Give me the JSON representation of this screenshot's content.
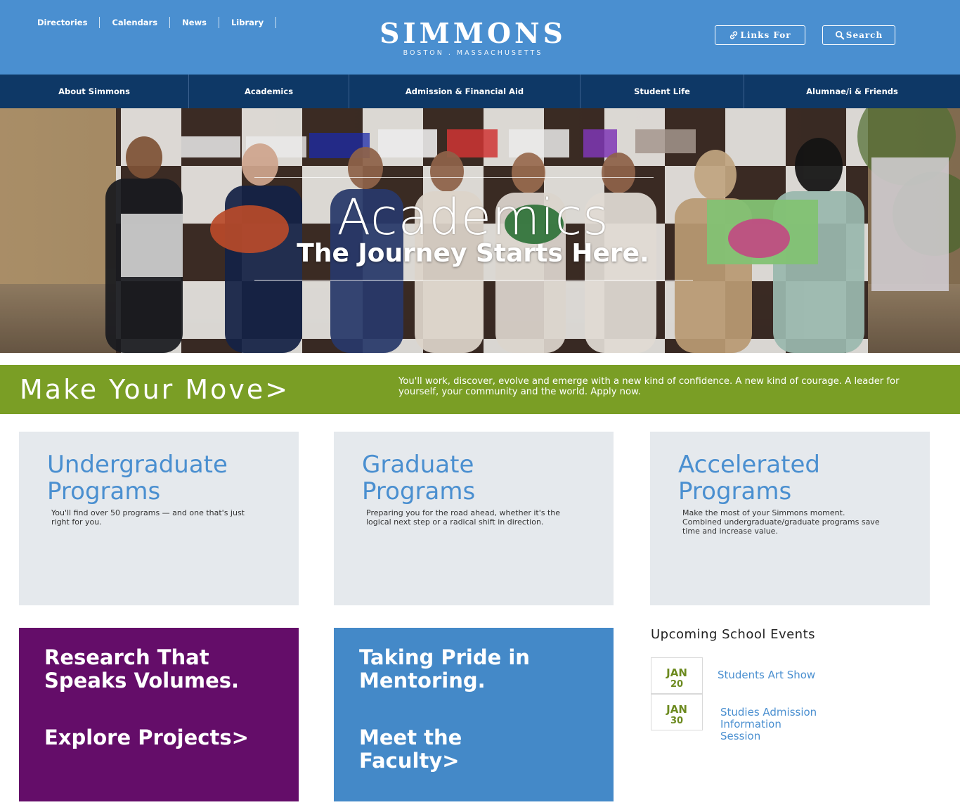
{
  "utility_nav": [
    "Directories",
    "Calendars",
    "News",
    "Library"
  ],
  "brand": {
    "name": "SIMMONS",
    "location": "BOSTON . MASSACHUSETTS"
  },
  "header_buttons": {
    "links_for": "Links For",
    "search": "Search"
  },
  "main_nav": [
    "About Simmons",
    "Academics",
    "Admission & Financial Aid",
    "Student Life",
    "Alumnae/i & Friends"
  ],
  "hero": {
    "title": "Academics",
    "subtitle": "The Journey Starts Here."
  },
  "move": {
    "title": "Make Your Move>",
    "text": "You'll work, discover, evolve and emerge with a new kind of confidence. A new kind of courage. A leader for yourself, your community and the world. Apply now."
  },
  "programs": [
    {
      "title_line1": "Undergraduate",
      "title_line2": "Programs",
      "description": "You'll find over 50 programs — and one that's just right for you."
    },
    {
      "title_line1": "Graduate",
      "title_line2": "Programs",
      "description": "Preparing you for the road ahead, whether it's the logical next step or a radical shift in direction."
    },
    {
      "title_line1": "Accelerated",
      "title_line2": "Programs",
      "description": "Make the most of your Simmons moment. Combined undergraduate/graduate programs save time and increase value."
    }
  ],
  "research": {
    "heading_line1": "Research That",
    "heading_line2": "Speaks Volumes.",
    "link": "Explore Projects>"
  },
  "mentoring": {
    "heading_line1": "Taking Pride in",
    "heading_line2": "Mentoring.",
    "link_line1": "Meet the",
    "link_line2": "Faculty>"
  },
  "events": {
    "heading": "Upcoming School Events",
    "items": [
      {
        "month": "JAN",
        "day": "20",
        "title_lines": [
          "Students Art Show"
        ]
      },
      {
        "month": "JAN",
        "day": "30",
        "title_lines": [
          "Studies Admission",
          "Information",
          "Session"
        ]
      }
    ]
  },
  "colors": {
    "header_blue": "#4a8fd0",
    "nav_navy": "#0e3866",
    "band_green": "#7a9e25",
    "card_gray": "#e5e9ed",
    "tile_purple": "#640d69",
    "tile_blue": "#4489c8"
  },
  "icons": {
    "links_for": "link-icon",
    "search": "search-icon"
  }
}
